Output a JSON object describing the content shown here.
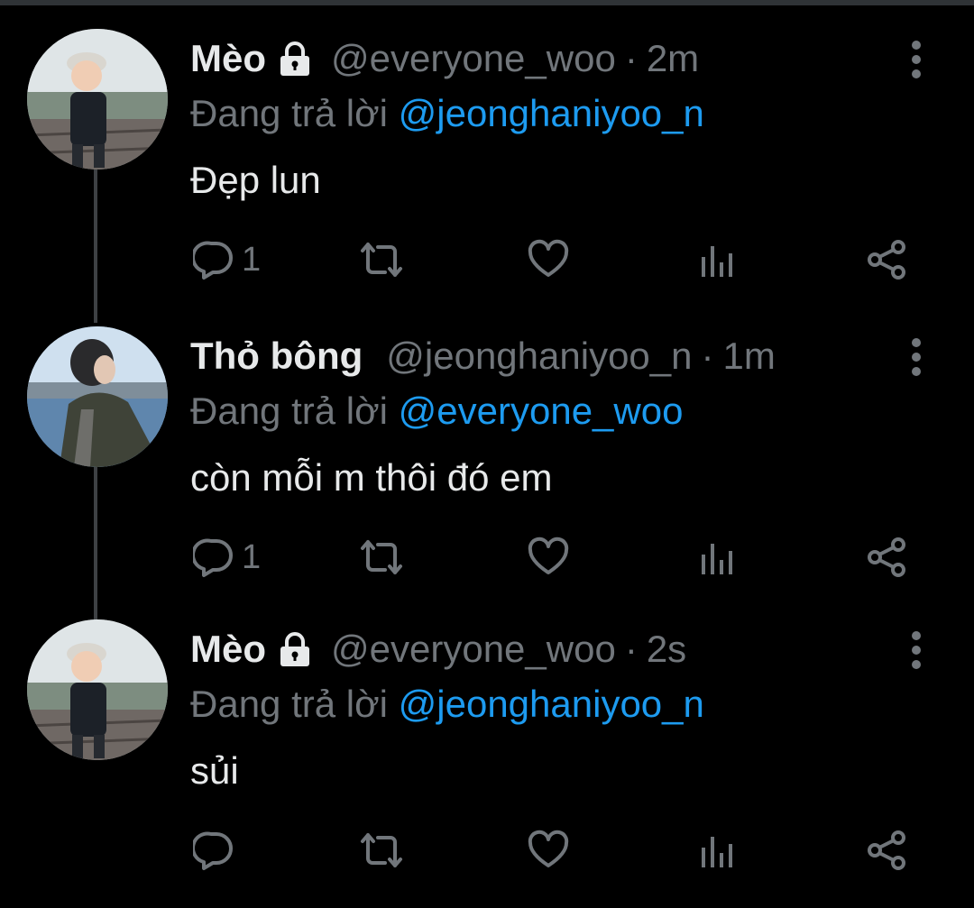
{
  "colors": {
    "background": "#000000",
    "text": "#e7e9ea",
    "muted": "#71767b",
    "link": "#1d9bf0"
  },
  "tweets": [
    {
      "name": "Mèo",
      "locked": true,
      "handle": "@everyone_woo",
      "separator": "·",
      "time": "2m",
      "reply_prefix": "Đang trả lời",
      "reply_to": "@jeonghaniyoo_n",
      "text": "Đẹp lun",
      "reply_count": "1",
      "avatar": "child-avatar"
    },
    {
      "name": "Thỏ bông",
      "locked": false,
      "handle": "@jeonghaniyoo_n",
      "separator": "·",
      "time": "1m",
      "reply_prefix": "Đang trả lời",
      "reply_to": "@everyone_woo",
      "text": "còn mỗi m thôi đó em",
      "reply_count": "1",
      "avatar": "person-avatar"
    },
    {
      "name": "Mèo",
      "locked": true,
      "handle": "@everyone_woo",
      "separator": "·",
      "time": "2s",
      "reply_prefix": "Đang trả lời",
      "reply_to": "@jeonghaniyoo_n",
      "text": "sủi",
      "reply_count": "",
      "avatar": "child-avatar"
    }
  ],
  "icons": [
    "comment-icon",
    "retweet-icon",
    "like-icon",
    "analytics-icon",
    "share-icon",
    "more-icon",
    "lock-icon"
  ]
}
